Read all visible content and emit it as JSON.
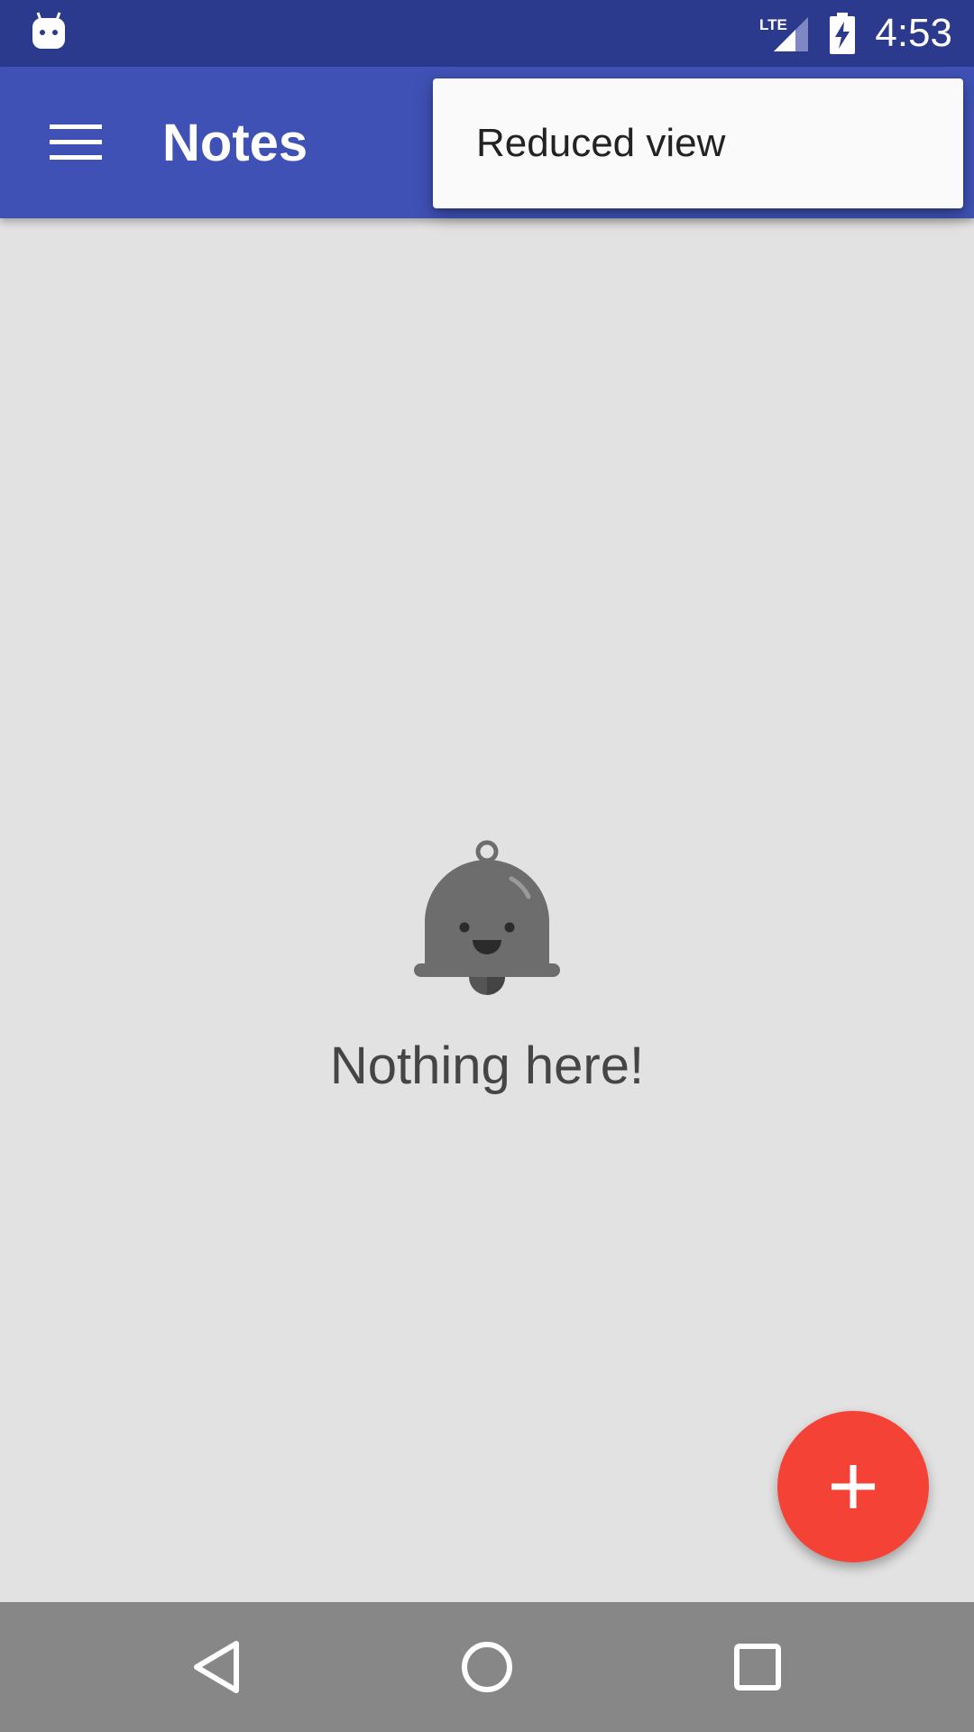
{
  "status_bar": {
    "time": "4:53",
    "network": "LTE",
    "icons": [
      "android-notification-icon",
      "lte-signal-icon",
      "battery-charging-icon"
    ]
  },
  "app_bar": {
    "title": "Notes",
    "menu_icon": "hamburger-menu-icon"
  },
  "popup_menu": {
    "items": [
      {
        "label": "Reduced view"
      }
    ]
  },
  "empty_state": {
    "icon": "bell-icon",
    "message": "Nothing here!"
  },
  "fab": {
    "icon": "plus-icon"
  },
  "nav_bar": {
    "icons": [
      "back-triangle-icon",
      "home-circle-icon",
      "recents-square-icon"
    ]
  },
  "colors": {
    "status_bar": "#2b3a8c",
    "app_bar": "#3f51b5",
    "background": "#e2e2e2",
    "fab": "#f44336",
    "nav_bar": "#878787"
  }
}
